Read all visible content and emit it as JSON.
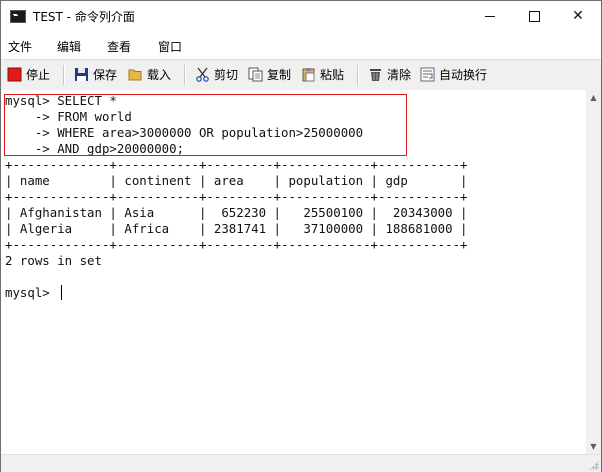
{
  "window": {
    "title": "TEST - 命令列介面",
    "minimize_icon": "minimize-icon",
    "maximize_icon": "maximize-icon",
    "close_glyph": "✕"
  },
  "menu": {
    "items": [
      "文件",
      "编辑",
      "查看",
      "窗口"
    ]
  },
  "toolbar": {
    "stop_label": "停止",
    "save_label": "保存",
    "load_label": "载入",
    "cut_label": "剪切",
    "copy_label": "复制",
    "paste_label": "粘贴",
    "clear_label": "清除",
    "autowrap_label": "自动换行",
    "icons": {
      "stop": "stop-icon",
      "save": "save-icon",
      "load": "folder-open-icon",
      "cut": "scissors-icon",
      "copy": "copy-icon",
      "paste": "clipboard-icon",
      "clear": "trash-icon",
      "autowrap": "wrap-icon"
    },
    "colors": {
      "stop": "#e01b1b",
      "save": "#1f3c8a",
      "folder": "#e8b84a"
    }
  },
  "console": {
    "text": "mysql> SELECT *\n    -> FROM world\n    -> WHERE area>3000000 OR population>25000000\n    -> AND gdp>20000000;\n+-------------+-----------+---------+------------+-----------+\n| name        | continent | area    | population | gdp       |\n+-------------+-----------+---------+------------+-----------+\n| Afghanistan | Asia      |  652230 |   25500100 |  20343000 |\n| Algeria     | Africa    | 2381741 |   37100000 | 188681000 |\n+-------------+-----------+---------+------------+-----------+\n2 rows in set\n\nmysql> ",
    "query_highlight_color": "#e0171c"
  },
  "scrollbar": {
    "up_glyph": "▲",
    "down_glyph": "▼"
  }
}
